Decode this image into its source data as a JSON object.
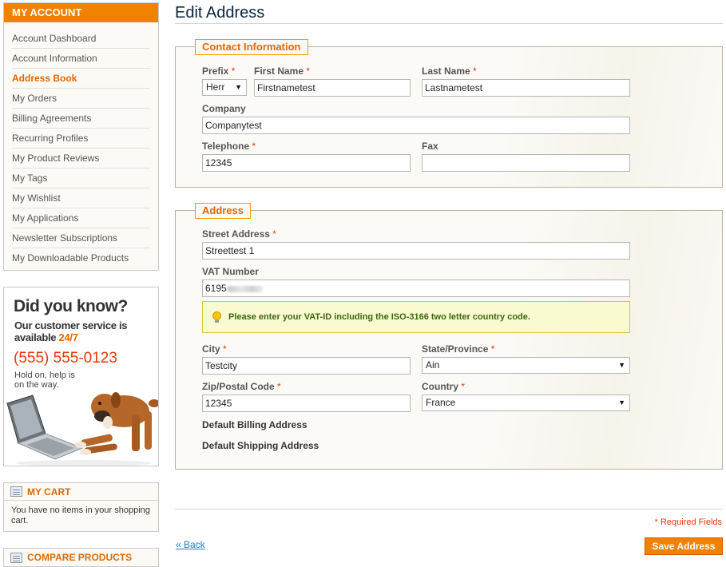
{
  "sidebar": {
    "account_title": "My Account",
    "items": [
      {
        "label": "Account Dashboard"
      },
      {
        "label": "Account Information"
      },
      {
        "label": "Address Book"
      },
      {
        "label": "My Orders"
      },
      {
        "label": "Billing Agreements"
      },
      {
        "label": "Recurring Profiles"
      },
      {
        "label": "My Product Reviews"
      },
      {
        "label": "My Tags"
      },
      {
        "label": "My Wishlist"
      },
      {
        "label": "My Applications"
      },
      {
        "label": "Newsletter Subscriptions"
      },
      {
        "label": "My Downloadable Products"
      }
    ],
    "active_item": "Address Book",
    "promo": {
      "headline": "Did you know?",
      "line_prefix": "Our customer service is available ",
      "highlight": "24/7",
      "phone": "(555) 555-0123",
      "note": "Hold on, help is on the way."
    },
    "cart": {
      "title": "My Cart",
      "empty_text": "You have no items in your shopping cart."
    },
    "compare": {
      "title": "Compare Products"
    }
  },
  "page": {
    "title": "Edit Address"
  },
  "contact": {
    "legend": "Contact Information",
    "prefix_label": "Prefix",
    "prefix_value": "Herr",
    "firstname_label": "First Name",
    "firstname_value": "Firstnametest",
    "lastname_label": "Last Name",
    "lastname_value": "Lastnametest",
    "company_label": "Company",
    "company_value": "Companytest",
    "telephone_label": "Telephone",
    "telephone_value": "12345",
    "fax_label": "Fax",
    "fax_value": ""
  },
  "address": {
    "legend": "Address",
    "street_label": "Street Address",
    "street_value": "Streettest 1",
    "vat_label": "VAT Number",
    "vat_value_visible": "6195",
    "vat_advice": "Please enter your VAT-ID including the ISO-3166 two letter country code.",
    "city_label": "City",
    "city_value": "Testcity",
    "state_label": "State/Province",
    "state_value": "Ain",
    "zip_label": "Zip/Postal Code",
    "zip_value": "12345",
    "country_label": "Country",
    "country_value": "France",
    "default_billing": "Default Billing Address",
    "default_shipping": "Default Shipping Address"
  },
  "footer": {
    "required_note": "* Required Fields",
    "back_label": "« Back",
    "save_label": "Save Address"
  },
  "required_marker": "*",
  "colors": {
    "accent": "#f18200",
    "accent_text": "#e26703",
    "required": "#eb340a",
    "title": "#0a263c",
    "link": "#1e7ec8",
    "advice_text": "#3d6611"
  }
}
